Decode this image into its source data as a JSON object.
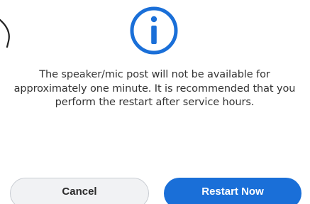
{
  "dialog": {
    "icon": "info-circle-icon",
    "message": "The speaker/mic post will not be available for approximately one minute. It is recommended that you perform the restart after service hours.",
    "cancel_label": "Cancel",
    "confirm_label": "Restart Now"
  },
  "colors": {
    "accent": "#1a6fd8",
    "text": "#333333",
    "secondary_button_bg": "#f1f2f4"
  }
}
